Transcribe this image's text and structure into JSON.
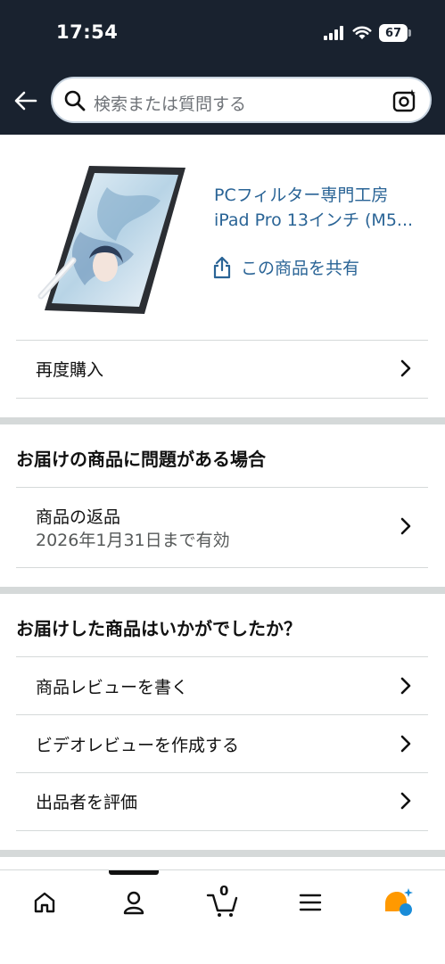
{
  "status_bar": {
    "time": "17:54",
    "battery": "67"
  },
  "header": {
    "search_placeholder": "検索または質問する"
  },
  "product": {
    "title": "PCフィルター専門工房 iPad Pro 13インチ (M5...",
    "share_label": "この商品を共有"
  },
  "rebuy": {
    "label": "再度購入"
  },
  "problem_section": {
    "title": "お届けの商品に問題がある場合",
    "return_label": "商品の返品",
    "return_sub": "2026年1月31日まで有効"
  },
  "feedback_section": {
    "title": "お届けした商品はいかがでしたか？",
    "items": [
      {
        "label": "商品レビューを書く"
      },
      {
        "label": "ビデオレビューを作成する"
      },
      {
        "label": "出品者を評価"
      }
    ]
  },
  "bottom_nav": {
    "cart_count": "0",
    "items": [
      "home-icon",
      "account-icon",
      "cart-icon",
      "menu-icon",
      "rufus-icon"
    ],
    "accent_color": "#ff9900",
    "assist_color": "#1a8cd8"
  }
}
